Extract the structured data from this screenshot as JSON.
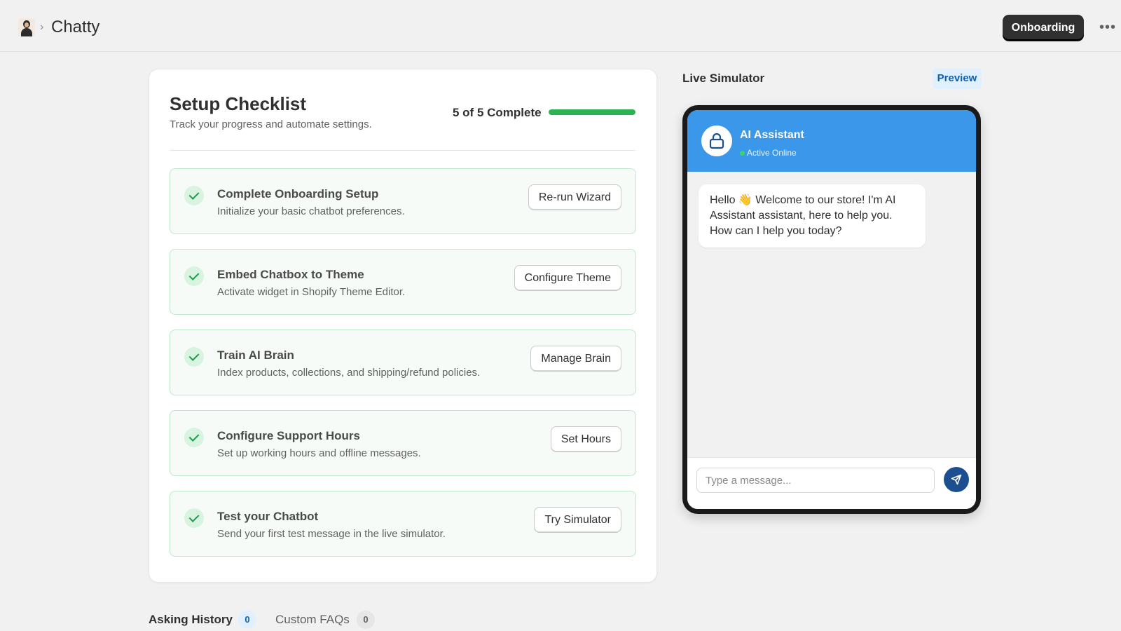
{
  "header": {
    "app_name": "Chatty",
    "primary_button": "Onboarding",
    "more_icon": "more-horizontal-icon"
  },
  "checklist": {
    "title": "Setup Checklist",
    "subtitle": "Track your progress and automate settings.",
    "progress_text": "5 of 5 Complete",
    "progress_fraction": 1.0,
    "progress_color": "#29b352",
    "items": [
      {
        "title": "Complete Onboarding Setup",
        "description": "Initialize your basic chatbot preferences.",
        "button": "Re-run Wizard",
        "done": true
      },
      {
        "title": "Embed Chatbox to Theme",
        "description": "Activate widget in Shopify Theme Editor.",
        "button": "Configure Theme",
        "done": true
      },
      {
        "title": "Train AI Brain",
        "description": "Index products, collections, and shipping/refund policies.",
        "button": "Manage Brain",
        "done": true
      },
      {
        "title": "Configure Support Hours",
        "description": "Set up working hours and offline messages.",
        "button": "Set Hours",
        "done": true
      },
      {
        "title": "Test your Chatbot",
        "description": "Send your first test message in the live simulator.",
        "button": "Try Simulator",
        "done": true
      }
    ]
  },
  "simulator": {
    "title": "Live Simulator",
    "badge": "Preview",
    "bot_name": "AI Assistant",
    "bot_status": "Active Online",
    "bot_icon": "lock-icon",
    "header_color": "#3b97ea",
    "message": "Hello 👋 Welcome to our store! I'm AI Assistant assistant, here to help you. How can I help you today?",
    "input_placeholder": "Type a message...",
    "send_icon": "send-icon"
  },
  "tabs": [
    {
      "label": "Asking History",
      "count": "0",
      "active": true
    },
    {
      "label": "Custom FAQs",
      "count": "0",
      "active": false
    }
  ]
}
